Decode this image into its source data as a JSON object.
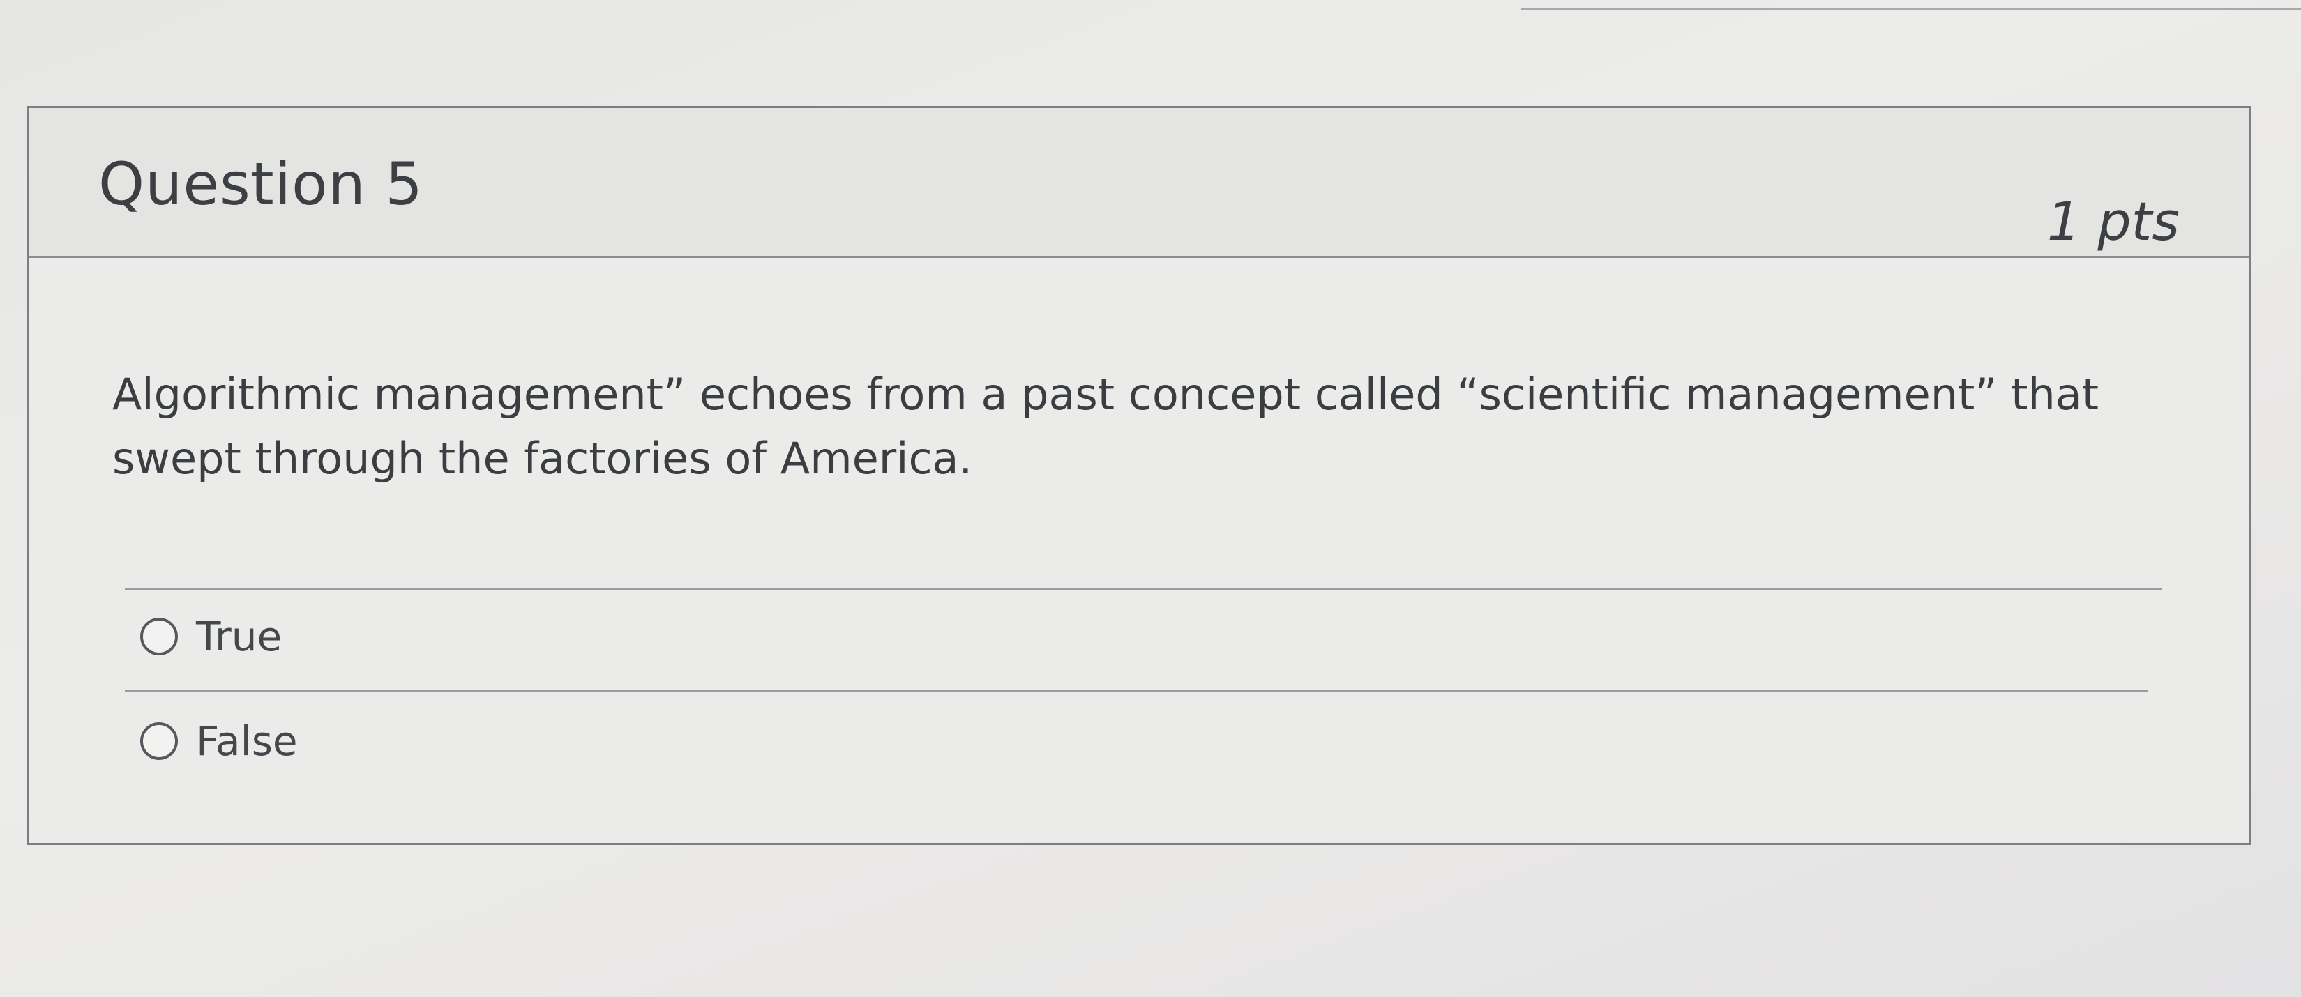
{
  "question": {
    "title": "Question 5",
    "points": "1 pts",
    "text": "Algorithmic management” echoes from a past concept called “scientific management” that swept through the factories of America."
  },
  "answers": [
    {
      "label": "True",
      "selected": false
    },
    {
      "label": "False",
      "selected": false
    }
  ],
  "colors": {
    "border": "#7c7f82",
    "header_background": "#e4e4e3",
    "text": "#3a3d41"
  }
}
